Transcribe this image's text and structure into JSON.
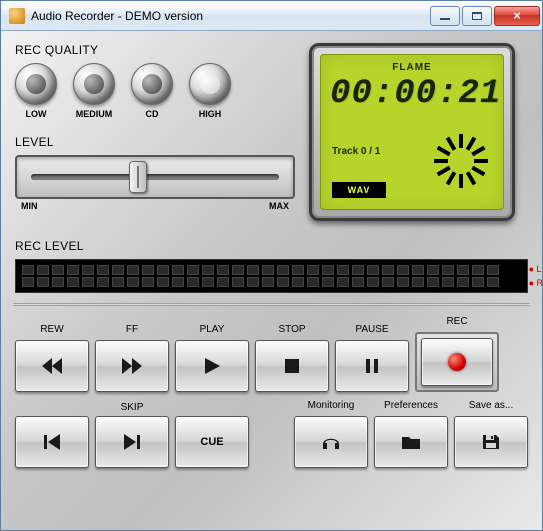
{
  "window": {
    "title": "Audio Recorder - DEMO version"
  },
  "quality": {
    "section": "REC QUALITY",
    "low": "LOW",
    "medium": "MEDIUM",
    "cd": "CD",
    "high": "HIGH",
    "selected": "HIGH"
  },
  "level": {
    "section": "LEVEL",
    "min": "MIN",
    "max": "MAX",
    "value_pct": 44
  },
  "lcd": {
    "title": "FLAME",
    "time": "00:00:21",
    "track": "Track 0 / 1",
    "format": "WAV"
  },
  "rec_level": {
    "section": "REC LEVEL",
    "left": "L",
    "right": "R"
  },
  "transport": {
    "rew": "REW",
    "ff": "FF",
    "play": "PLAY",
    "stop": "STOP",
    "pause": "PAUSE",
    "rec": "REC"
  },
  "bottom": {
    "skip": "SKIP",
    "cue": "CUE",
    "monitoring": "Monitoring",
    "preferences": "Preferences",
    "saveas": "Save as..."
  }
}
